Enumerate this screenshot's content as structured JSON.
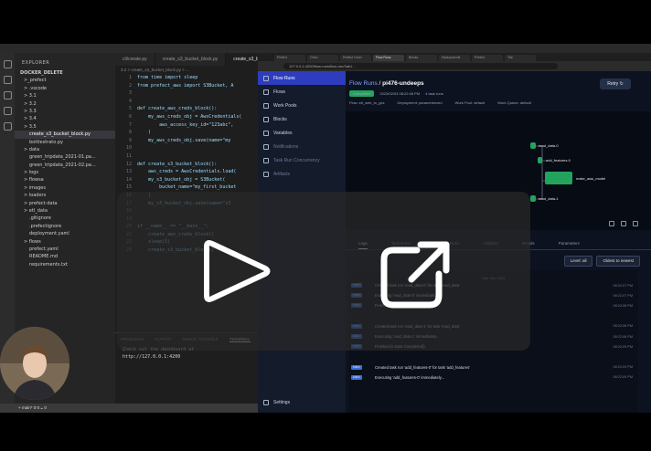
{
  "vscode": {
    "explorer_title": "EXPLORER",
    "root_folder": "DOCKER_DELETE",
    "files": [
      ">_prefect",
      "> .vscode",
      "> 3.1",
      "> 3.2",
      "> 3.3",
      "> 3.4",
      "> 3.5",
      "create_s3_bucket_block.py",
      "bottlestrato.py",
      "> data",
      "green_tripdata_2021-01.pa...",
      "green_tripdata_2021-02.pa...",
      "> logs",
      "> flowsa",
      "> images",
      "> loaders",
      "> prefect-data",
      "> etl_data",
      ".gitignore",
      ".prefectignore",
      "deployment.yaml",
      "> flows",
      "prefect.yaml",
      "README.md",
      "requirements.txt"
    ],
    "selected_file_index": 7,
    "editor_tabs": [
      "cli/create.py",
      "create_s3_bucket_block.py",
      "create_s3_bucket_block.py"
    ],
    "active_tab_index": 2,
    "breadcrumb": "3.2 > create_s3_bucket_block.py > ...",
    "code_lines": [
      {
        "n": "1",
        "t": "from time import sleep"
      },
      {
        "n": "2",
        "t": "from prefect_aws import S3Bucket, A"
      },
      {
        "n": "3",
        "t": ""
      },
      {
        "n": "4",
        "t": ""
      },
      {
        "n": "5",
        "t": "def create_aws_creds_block():"
      },
      {
        "n": "6",
        "t": "    my_aws_creds_obj = AwsCredentials("
      },
      {
        "n": "7",
        "t": "        aws_access_key_id=\"123abc\","
      },
      {
        "n": "8",
        "t": "    )"
      },
      {
        "n": "9",
        "t": "    my_aws_creds_obj.save(name=\"my"
      },
      {
        "n": "10",
        "t": ""
      },
      {
        "n": "11",
        "t": ""
      },
      {
        "n": "12",
        "t": "def create_s3_bucket_block():"
      },
      {
        "n": "13",
        "t": "    aws_creds = AwsCredentials.load("
      },
      {
        "n": "14",
        "t": "    my_s3_bucket_obj = S3Bucket("
      },
      {
        "n": "15",
        "t": "        bucket_name=\"my_first_bucket"
      },
      {
        "n": "16",
        "t": "    )"
      },
      {
        "n": "17",
        "t": "    my_s3_bucket_obj.save(name=\"s3"
      },
      {
        "n": "18",
        "t": ""
      },
      {
        "n": "19",
        "t": ""
      },
      {
        "n": "20",
        "t": "if __name__ == \"__main__\":"
      },
      {
        "n": "21",
        "t": "    create_aws_creds_block()"
      },
      {
        "n": "22",
        "t": "    sleep(5)"
      },
      {
        "n": "23",
        "t": "    create_s3_bucket_block()"
      }
    ],
    "terminal_tabs": [
      "PROBLEMS",
      "OUTPUT",
      "DEBUG CONSOLE",
      "TERMINAL"
    ],
    "terminal_lines": [
      "Check out the dashboard at",
      "http://127.0.0.1:4200"
    ],
    "status_text": "⑂ main*   ⊗ 0 ⚠ 0"
  },
  "browser": {
    "tabs": [
      "Prefect",
      "Orion",
      "Prefect Orion",
      "Flow Runs",
      "Blocks",
      "Deployments",
      "Prefect",
      "Tab"
    ],
    "active_tab_index": 3,
    "url": "127.0.0.1:4200/flow-runs/flow-run/3ab1..."
  },
  "prefect": {
    "nav": [
      {
        "label": "Flow Runs",
        "active": true,
        "dim": false
      },
      {
        "label": "Flows",
        "active": false,
        "dim": false
      },
      {
        "label": "Work Pools",
        "active": false,
        "dim": false
      },
      {
        "label": "Blocks",
        "active": false,
        "dim": false
      },
      {
        "label": "Variables",
        "active": false,
        "dim": false
      },
      {
        "label": "Notifications",
        "active": false,
        "dim": true
      },
      {
        "label": "Task Run Concurrency",
        "active": false,
        "dim": true
      },
      {
        "label": "Artifacts",
        "active": false,
        "dim": true
      }
    ],
    "settings_label": "Settings",
    "breadcrumb_link": "Flow Runs",
    "breadcrumb_sep": " / ",
    "run_name": "pi476-undeeps",
    "run_button": "Retry ↻",
    "status_badge": "Completed",
    "meta": [
      "2023/02/03 08:22:06 PM",
      "4 task runs"
    ],
    "info": [
      "Flow: etl_web_to_gcs",
      "Deployment: parameterized",
      "Work Pool: default",
      "Work Queue: default"
    ],
    "graph_nodes": [
      {
        "label": "read_data-0"
      },
      {
        "label": "add_features-0"
      },
      {
        "label": "make_aws_model"
      },
      {
        "label": "read_data-1"
      }
    ],
    "log_tabs": [
      "Logs",
      "Task Runs",
      "Subflow Runs",
      "Artifacts",
      "Details",
      "Parameters"
    ],
    "active_log_tab": 0,
    "level_select": "Level: all",
    "sort_select": "Oldest to newest",
    "log_date": "Mar 3rd, 2023",
    "logs": [
      {
        "lvl": "INFO",
        "msg": "Created task run 'read_data-0' for task 'read_data'",
        "ts": "08:22:07 PM"
      },
      {
        "lvl": "INFO",
        "msg": "Executing 'read_data-0' immediately...",
        "ts": "08:22:07 PM"
      },
      {
        "lvl": "INFO",
        "msg": "Finished in state Completed()",
        "ts": "08:22:08 PM"
      },
      {
        "lvl": "",
        "msg": "",
        "ts": ""
      },
      {
        "lvl": "INFO",
        "msg": "Created task run 'read_data-1' for task 'read_data'",
        "ts": "08:22:08 PM"
      },
      {
        "lvl": "INFO",
        "msg": "Executing 'read_data-1' immediately...",
        "ts": "08:22:08 PM"
      },
      {
        "lvl": "INFO",
        "msg": "Finished in state Completed()",
        "ts": "08:22:09 PM"
      },
      {
        "lvl": "",
        "msg": "",
        "ts": ""
      },
      {
        "lvl": "INFO",
        "msg": "Created task run 'add_features-0' for task 'add_features'",
        "ts": "08:22:09 PM"
      },
      {
        "lvl": "INFO",
        "msg": "Executing 'add_features-0' immediately...",
        "ts": "08:22:09 PM"
      }
    ]
  },
  "colors": {
    "accent": "#2d3dbd",
    "success": "#22a45e",
    "log_level": "#3b6fd9"
  },
  "overlay": {
    "play_icon": "play-icon",
    "share_icon": "external-link-icon"
  }
}
